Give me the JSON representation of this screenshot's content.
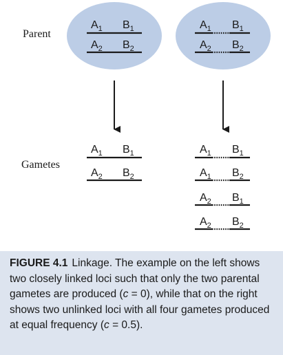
{
  "labels": {
    "parent": "Parent",
    "gametes": "Gametes"
  },
  "alleles": {
    "a": "A",
    "b": "B",
    "sub1": "1",
    "sub2": "2"
  },
  "caption": {
    "label": "FIGURE 4.1",
    "text_1": "Linkage. The example on the left shows two closely linked loci such that only the two parental gametes are produced (",
    "c1_var": "c",
    "c1_rest": " = 0), while that on the right shows two unlinked loci with all four gametes produced at equal frequency (",
    "c2_var": "c",
    "c2_rest": " = 0.5)."
  },
  "colors": {
    "ellipse": "#bccde6",
    "caption_bg": "#dde4ef",
    "line": "#1a1a1a"
  }
}
